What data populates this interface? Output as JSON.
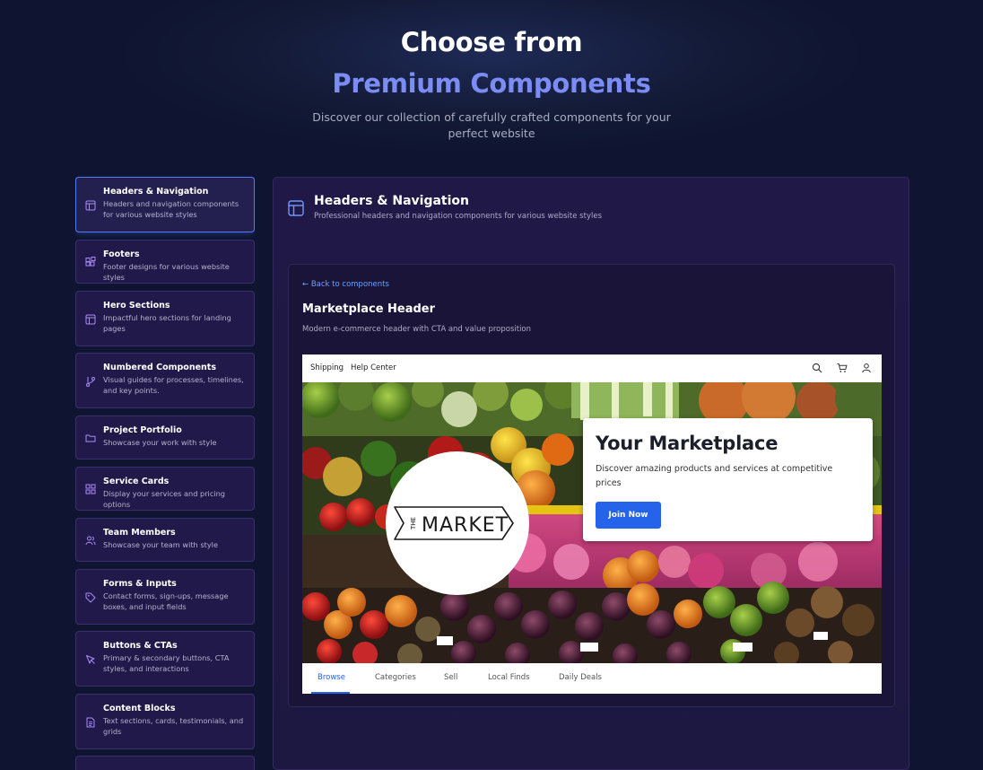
{
  "hero": {
    "title_line1": "Choose from",
    "title_line2": "Premium Components",
    "subtitle": "Discover our collection of carefully crafted components for your perfect website"
  },
  "colors": {
    "accent": "#7b8cf5",
    "link": "#6fa0ff",
    "primary_button": "#2563eb",
    "active_border": "#4f7bff",
    "icon": "#a98bf5"
  },
  "sidebar": {
    "items": [
      {
        "title": "Headers & Navigation",
        "desc": "Headers and navigation components for various website styles",
        "icon": "layout-icon",
        "active": true
      },
      {
        "title": "Footers",
        "desc": "Footer designs for various website styles",
        "icon": "blocks-icon"
      },
      {
        "title": "Hero Sections",
        "desc": "Impactful hero sections for landing pages",
        "icon": "layout-icon"
      },
      {
        "title": "Numbered Components",
        "desc": "Visual guides for processes, timelines, and key points.",
        "icon": "git-branch-icon"
      },
      {
        "title": "Project Portfolio",
        "desc": "Showcase your work with style",
        "icon": "folder-icon"
      },
      {
        "title": "Service Cards",
        "desc": "Display your services and pricing options",
        "icon": "grid-icon"
      },
      {
        "title": "Team Members",
        "desc": "Showcase your team with style",
        "icon": "users-icon"
      },
      {
        "title": "Forms & Inputs",
        "desc": "Contact forms, sign-ups, message boxes, and input fields",
        "icon": "tag-icon"
      },
      {
        "title": "Buttons & CTAs",
        "desc": "Primary & secondary buttons, CTA styles, and interactions",
        "icon": "cursor-icon"
      },
      {
        "title": "Content Blocks",
        "desc": "Text sections, cards, testimonials, and grids",
        "icon": "document-icon"
      }
    ]
  },
  "panel": {
    "title": "Headers & Navigation",
    "subtitle": "Professional headers and navigation components for various website styles",
    "icon": "layout-icon"
  },
  "component": {
    "back_link": "← Back to components",
    "title": "Marketplace Header",
    "subtitle": "Modern e-commerce header with CTA and value proposition"
  },
  "preview": {
    "top_links": [
      "Shipping",
      "Help Center"
    ],
    "top_icons": [
      "search-icon",
      "cart-icon",
      "user-icon"
    ],
    "logo_text": "MARKET",
    "logo_prefix": "THE",
    "cta": {
      "title": "Your Marketplace",
      "description": "Discover amazing products and services at competitive prices",
      "button": "Join Now"
    },
    "tabs": [
      {
        "label": "Browse",
        "active": true
      },
      {
        "label": "Categories"
      },
      {
        "label": "Sell"
      },
      {
        "label": "Local Finds"
      },
      {
        "label": "Daily Deals"
      }
    ]
  }
}
